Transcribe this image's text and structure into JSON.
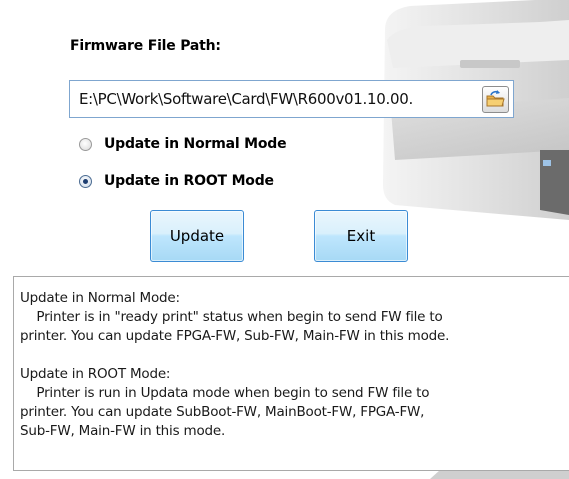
{
  "firmware": {
    "label": "Firmware File Path:",
    "path_value": "E:\\PC\\Work\\Software\\Card\\FW\\R600v01.10.00.",
    "browse_icon": "folder-refresh-icon"
  },
  "modes": [
    {
      "label": "Update in Normal Mode",
      "selected": false
    },
    {
      "label": "Update in ROOT Mode",
      "selected": true
    }
  ],
  "buttons": {
    "update": "Update",
    "exit": "Exit"
  },
  "info": {
    "normal_title": "Update in Normal Mode:",
    "normal_line1": "    Printer is in \"ready print\" status when begin to send FW file to",
    "normal_line2": "printer. You can update FPGA-FW, Sub-FW, Main-FW in this mode.",
    "root_title": "Update in ROOT Mode:",
    "root_line1": "    Printer is run in Updata mode when begin to send FW file to",
    "root_line2": "printer. You can update SubBoot-FW, MainBoot-FW, FPGA-FW,",
    "root_line3": "Sub-FW, Main-FW in this mode."
  }
}
